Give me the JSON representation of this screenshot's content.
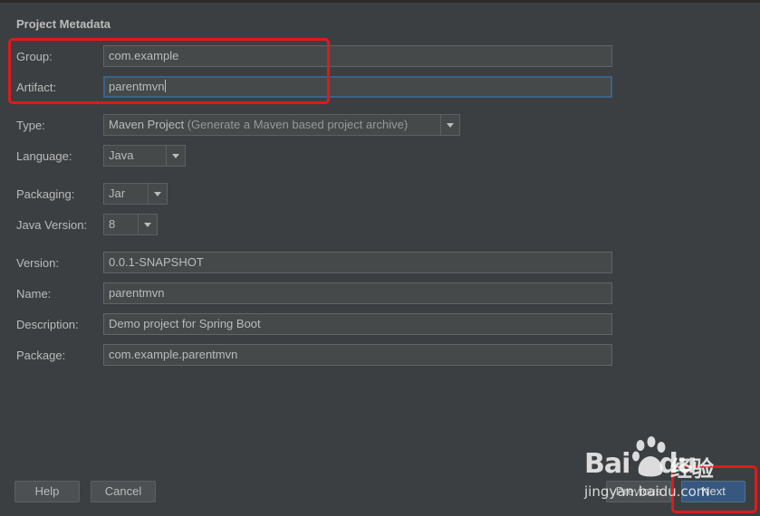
{
  "section_title": "Project Metadata",
  "fields": {
    "group": {
      "label": "Group:",
      "value": "com.example"
    },
    "artifact": {
      "label": "Artifact:",
      "value": "parentmvn"
    },
    "version": {
      "label": "Version:",
      "value": "0.0.1-SNAPSHOT"
    },
    "name": {
      "label": "Name:",
      "value": "parentmvn"
    },
    "description": {
      "label": "Description:",
      "value": "Demo project for Spring Boot"
    },
    "package": {
      "label": "Package:",
      "value": "com.example.parentmvn"
    }
  },
  "selects": {
    "type": {
      "label": "Type:",
      "value": "Maven Project",
      "value_desc": "(Generate a Maven based project archive)"
    },
    "language": {
      "label": "Language:",
      "value": "Java"
    },
    "packaging": {
      "label": "Packaging:",
      "value": "Jar"
    },
    "java_version": {
      "label": "Java Version:",
      "value": "8"
    }
  },
  "buttons": {
    "help": "Help",
    "cancel": "Cancel",
    "previous": "Previous",
    "next": "Next"
  },
  "watermark": {
    "logo_text": "Bai",
    "logo_suffix": "du",
    "cn_text": "经验",
    "url": "jingyan.baidu.com"
  },
  "colors": {
    "background": "#3c3f41",
    "field_background": "#45494a",
    "focus_border": "#3d6185",
    "default_button": "#365880",
    "highlight_box": "#e0191d"
  }
}
